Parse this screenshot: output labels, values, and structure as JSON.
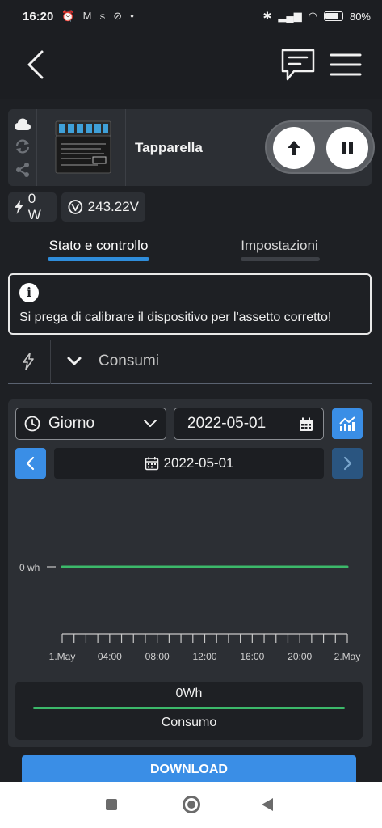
{
  "status_bar": {
    "time": "16:20",
    "battery": "80%"
  },
  "device": {
    "name": "Tapparella",
    "power": "0 W",
    "voltage": "243.22V"
  },
  "tabs": [
    {
      "label": "Stato e controllo",
      "active": true
    },
    {
      "label": "Impostazioni",
      "active": false
    }
  ],
  "alert": {
    "message": "Si prega di calibrare il dispositivo per l'assetto corretto!"
  },
  "consumption": {
    "section_label": "Consumi",
    "period_select": "Giorno",
    "date_input": "2022-05-01",
    "nav_date": "2022-05-01",
    "total": "0Wh",
    "series_name": "Consumo",
    "download_label": "DOWNLOAD"
  },
  "colors": {
    "accent": "#3a8ee6",
    "series": "#3cb96a",
    "background": "#1e2024",
    "card": "#2c2f34"
  },
  "chart_data": {
    "type": "line",
    "x": [
      "1.May",
      "04:00",
      "08:00",
      "12:00",
      "16:00",
      "20:00",
      "2.May"
    ],
    "x_tick_labels": [
      "1.May",
      "04:00",
      "08:00",
      "12:00",
      "16:00",
      "20:00",
      "2.May"
    ],
    "y_tick_labels": [
      "0 wh"
    ],
    "series": [
      {
        "name": "Consumo",
        "values": [
          0,
          0,
          0,
          0,
          0,
          0,
          0
        ]
      }
    ],
    "title": "",
    "xlabel": "",
    "ylabel": "",
    "grid": false,
    "legend": "bottom"
  }
}
